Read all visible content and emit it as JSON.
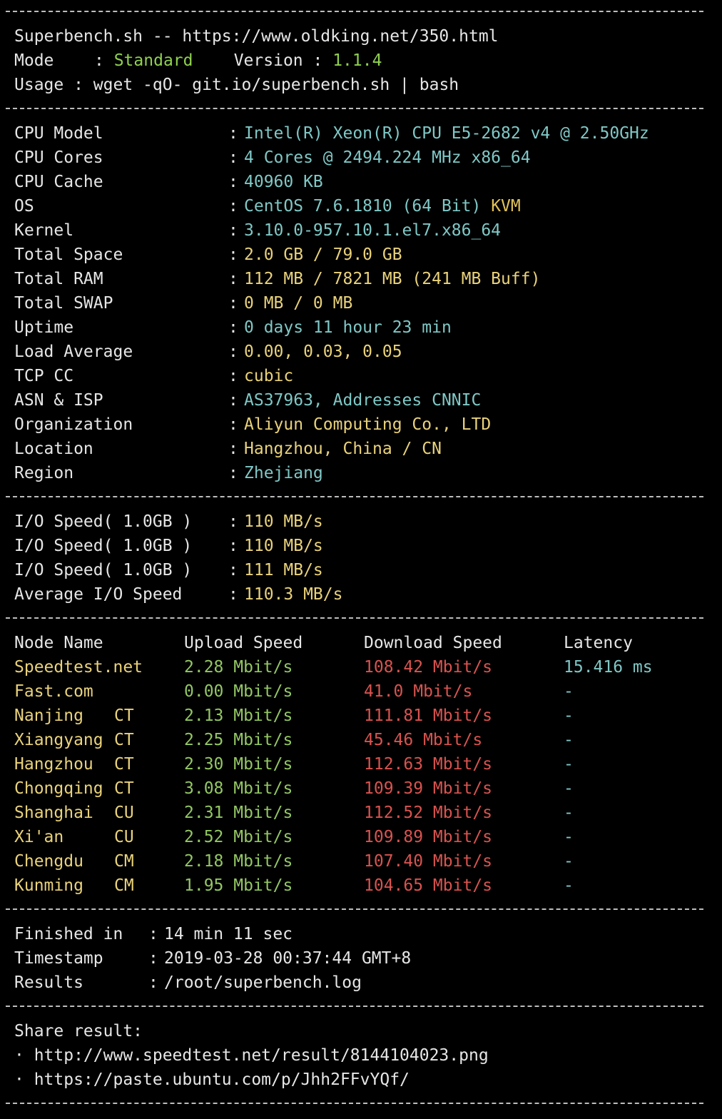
{
  "header": {
    "title": "Superbench.sh -- https://www.oldking.net/350.html",
    "mode_label": "Mode",
    "mode_value": "Standard",
    "version_label": "Version",
    "version_value": "1.1.4",
    "usage_label": "Usage",
    "usage_value": "wget -qO- git.io/superbench.sh | bash"
  },
  "sysinfo": [
    {
      "label": "CPU Model",
      "value": "Intel(R) Xeon(R) CPU E5-2682 v4 @ 2.50GHz",
      "extra": ""
    },
    {
      "label": "CPU Cores",
      "value": "4 Cores @ 2494.224 MHz x86_64",
      "extra": ""
    },
    {
      "label": "CPU Cache",
      "value": "40960 KB",
      "extra": ""
    },
    {
      "label": "OS",
      "value": "CentOS 7.6.1810 (64 Bit)",
      "extra": "KVM"
    },
    {
      "label": "Kernel",
      "value": "3.10.0-957.10.1.el7.x86_64",
      "extra": ""
    },
    {
      "label": "Total Space",
      "value": "2.0 GB / 79.0 GB",
      "extra": ""
    },
    {
      "label": "Total RAM",
      "value": "112 MB / 7821 MB (241 MB Buff)",
      "extra": ""
    },
    {
      "label": "Total SWAP",
      "value": "0 MB / 0 MB",
      "extra": ""
    },
    {
      "label": "Uptime",
      "value": "0 days 11 hour 23 min",
      "extra": ""
    },
    {
      "label": "Load Average",
      "value": "0.00, 0.03, 0.05",
      "extra": ""
    },
    {
      "label": "TCP CC",
      "value": "cubic",
      "extra": ""
    },
    {
      "label": "ASN & ISP",
      "value": "AS37963, Addresses CNNIC",
      "extra": ""
    },
    {
      "label": "Organization",
      "value": "Aliyun Computing Co., LTD",
      "extra": ""
    },
    {
      "label": "Location",
      "value": "Hangzhou, China / CN",
      "extra": ""
    },
    {
      "label": "Region",
      "value": "Zhejiang",
      "extra": ""
    }
  ],
  "io": [
    {
      "label": "I/O Speed( 1.0GB )",
      "value": "110 MB/s"
    },
    {
      "label": "I/O Speed( 1.0GB )",
      "value": "110 MB/s"
    },
    {
      "label": "I/O Speed( 1.0GB )",
      "value": "111 MB/s"
    },
    {
      "label": "Average I/O Speed",
      "value": "110.3 MB/s"
    }
  ],
  "speed": {
    "headers": {
      "node": "Node Name",
      "upload": "Upload Speed",
      "download": "Download Speed",
      "latency": "Latency"
    },
    "first_row": {
      "node": "Speedtest.net",
      "upload": "2.28 Mbit/s",
      "download": "108.42 Mbit/s",
      "latency": "15.416 ms"
    },
    "rows": [
      {
        "city": "Fast.com",
        "isp": "",
        "upload": "0.00 Mbit/s",
        "download": "41.0 Mbit/s",
        "latency": "-"
      },
      {
        "city": "Nanjing",
        "isp": "CT",
        "upload": "2.13 Mbit/s",
        "download": "111.81 Mbit/s",
        "latency": "-"
      },
      {
        "city": "Xiangyang",
        "isp": "CT",
        "upload": "2.25 Mbit/s",
        "download": "45.46 Mbit/s",
        "latency": "-"
      },
      {
        "city": "Hangzhou",
        "isp": "CT",
        "upload": "2.30 Mbit/s",
        "download": "112.63 Mbit/s",
        "latency": "-"
      },
      {
        "city": "Chongqing",
        "isp": "CT",
        "upload": "3.08 Mbit/s",
        "download": "109.39 Mbit/s",
        "latency": "-"
      },
      {
        "city": "Shanghai",
        "isp": "CU",
        "upload": "2.31 Mbit/s",
        "download": "112.52 Mbit/s",
        "latency": "-"
      },
      {
        "city": "Xi'an",
        "isp": "CU",
        "upload": "2.52 Mbit/s",
        "download": "109.89 Mbit/s",
        "latency": "-"
      },
      {
        "city": "Chengdu",
        "isp": "CM",
        "upload": "2.18 Mbit/s",
        "download": "107.40 Mbit/s",
        "latency": "-"
      },
      {
        "city": "Kunming",
        "isp": "CM",
        "upload": "1.95 Mbit/s",
        "download": "104.65 Mbit/s",
        "latency": "-"
      }
    ]
  },
  "footer": {
    "finished_label": "Finished in",
    "finished_value": "14 min 11 sec",
    "timestamp_label": "Timestamp",
    "timestamp_value": "2019-03-28 00:37:44 GMT+8",
    "results_label": "Results",
    "results_value": "/root/superbench.log"
  },
  "share": {
    "heading": "Share result:",
    "links": [
      "· http://www.speedtest.net/result/8144104023.png",
      "· https://paste.ubuntu.com/p/Jhh2FFvYQf/"
    ]
  },
  "colors": {
    "background": "#000000",
    "text": "#e6e6e6",
    "green": "#8fd14f",
    "yellow": "#e9d27a",
    "cyan": "#7fc8c6",
    "red": "#d9534f"
  }
}
